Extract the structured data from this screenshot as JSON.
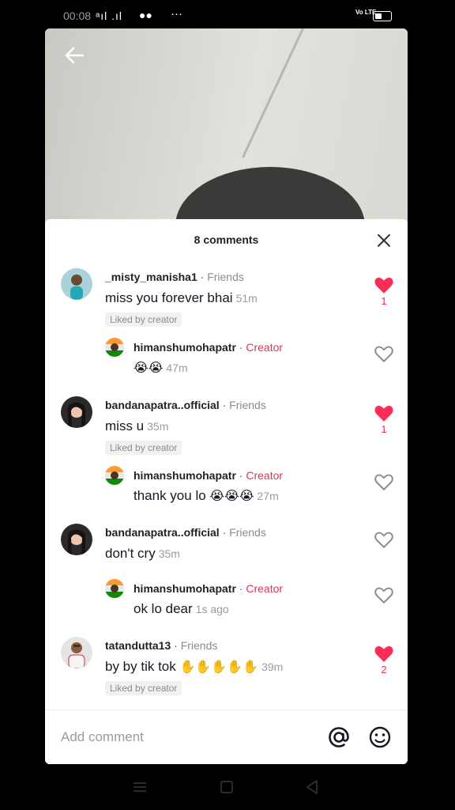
{
  "status_bar": {
    "time": "00:08",
    "signal": "ᵃıl .ıl",
    "app_icons": "●●",
    "dots": "···",
    "volte": "Vo LTE"
  },
  "comments_sheet": {
    "title": "8 comments"
  },
  "comments": [
    {
      "user": "_misty_manisha1",
      "tag": "Friends",
      "text": "miss you forever bhai",
      "time": "51m",
      "liked_by_creator": "Liked by creator",
      "likes": "1",
      "liked": true
    },
    {
      "user": "himanshumohapatr",
      "tag": "Creator",
      "text": "",
      "emoji": "😭😭",
      "time": "47m",
      "reply": true,
      "liked": false
    },
    {
      "user": "bandanapatra..official",
      "tag": "Friends",
      "text": "miss u",
      "time": "35m",
      "liked_by_creator": "Liked by creator",
      "likes": "1",
      "liked": true
    },
    {
      "user": "himanshumohapatr",
      "tag": "Creator",
      "text": "thank you lo",
      "emoji": "😭😭😭",
      "time": "27m",
      "reply": true,
      "liked": false
    },
    {
      "user": "bandanapatra..official",
      "tag": "Friends",
      "text": "don't cry",
      "time": "35m",
      "liked": false
    },
    {
      "user": "himanshumohapatr",
      "tag": "Creator",
      "text": "ok lo dear",
      "time": "1s ago",
      "reply": true,
      "liked": false
    },
    {
      "user": "tatandutta13",
      "tag": "Friends",
      "text": "by by tik tok",
      "emoji": "✋✋✋✋✋",
      "time": "39m",
      "liked_by_creator": "Liked by creator",
      "likes": "2",
      "liked": true
    }
  ],
  "footer": {
    "placeholder": "Add comment"
  },
  "colors": {
    "accent": "#e5315a",
    "friends_tag": "#8a8b91"
  },
  "icons": [
    "back-arrow-icon",
    "close-icon",
    "heart-icon",
    "at-sign-icon",
    "emoji-icon",
    "menu-icon",
    "home-square-icon",
    "back-triangle-icon"
  ]
}
